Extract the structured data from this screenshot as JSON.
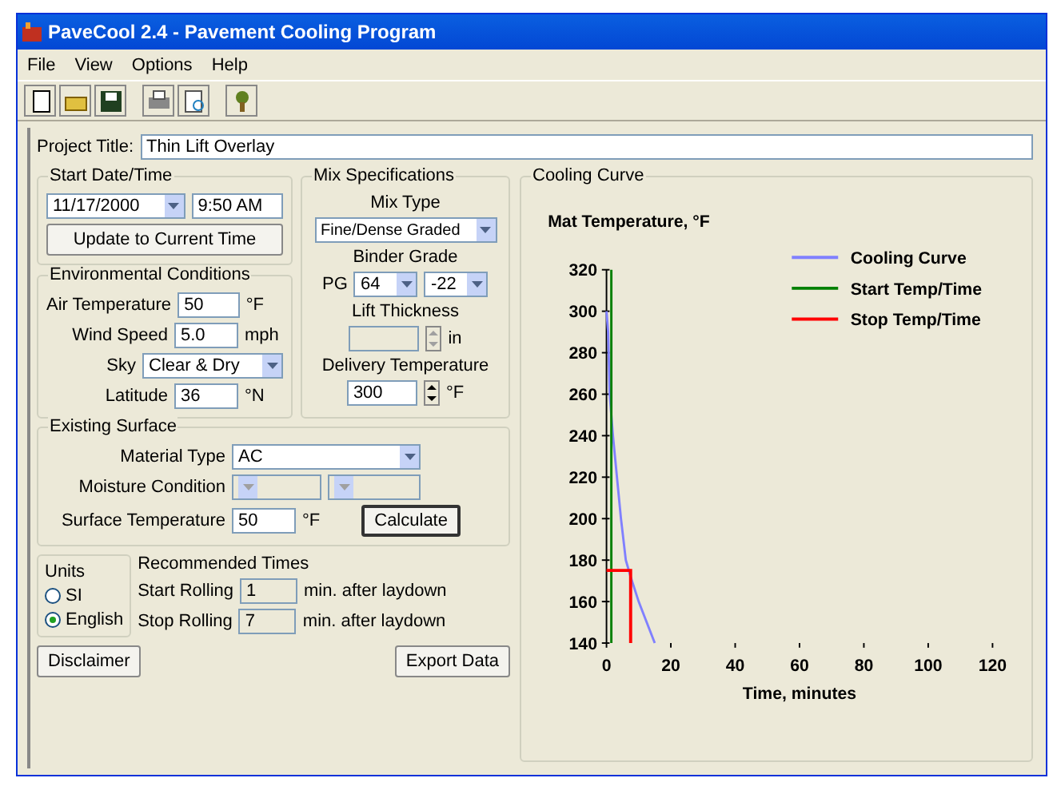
{
  "window": {
    "title": "PaveCool 2.4 - Pavement Cooling Program"
  },
  "menu": [
    {
      "label": "File"
    },
    {
      "label": "View"
    },
    {
      "label": "Options"
    },
    {
      "label": "Help"
    }
  ],
  "project_title": {
    "label": "Project Title:",
    "value": "Thin Lift Overlay"
  },
  "start_datetime": {
    "title": "Start Date/Time",
    "date": "11/17/2000",
    "time": "9:50 AM",
    "button": "Update to Current Time"
  },
  "environment": {
    "title": "Environmental Conditions",
    "fields": [
      {
        "kind": "text",
        "label": "Air Temperature",
        "value": "50",
        "unit": "°F"
      },
      {
        "kind": "text",
        "label": "Wind Speed",
        "value": "5.0",
        "unit": "mph"
      },
      {
        "kind": "dropdown",
        "label": "Sky",
        "value": "Clear & Dry"
      },
      {
        "kind": "text",
        "label": "Latitude",
        "value": "36",
        "unit": "°N"
      }
    ]
  },
  "mix": {
    "title": "Mix Specifications",
    "mix_type_label": "Mix Type",
    "mix_type": "Fine/Dense Graded",
    "binder_label": "Binder Grade",
    "pg_label": "PG",
    "binder_high": "64",
    "binder_low": "-22",
    "lift_label": "Lift Thickness",
    "lift_unit": "in",
    "lift_disabled": true,
    "delivery_label": "Delivery Temperature",
    "delivery_value": "300",
    "delivery_unit": "°F"
  },
  "existing_surface": {
    "title": "Existing Surface",
    "material_label": "Material Type",
    "material": "AC",
    "moisture_label": "Moisture Condition",
    "moisture_disabled": true,
    "surface_temp_label": "Surface Temperature",
    "surface_temp": "50",
    "surface_temp_unit": "°F",
    "calculate": "Calculate"
  },
  "units": {
    "title": "Units",
    "options": [
      {
        "label": "SI",
        "selected": false
      },
      {
        "label": "English",
        "selected": true
      }
    ]
  },
  "recommended": {
    "title": "Recommended Times",
    "rows": [
      {
        "label": "Start Rolling",
        "value": "1",
        "suffix": "min. after laydown"
      },
      {
        "label": "Stop Rolling",
        "value": "7",
        "suffix": "min. after laydown"
      }
    ]
  },
  "buttons": [
    {
      "label": "Disclaimer"
    },
    {
      "label": "Export Data"
    }
  ],
  "cooling_curve": {
    "title": "Cooling Curve",
    "chart_data": {
      "type": "line",
      "ylabel": "Mat Temperature, °F",
      "xlabel": "Time, minutes",
      "legend": "upper right",
      "series": [
        {
          "name": "Cooling Curve",
          "color": "#8080ff",
          "x": [
            0,
            0.5,
            1,
            2,
            4.5,
            6,
            7.5,
            10,
            15
          ],
          "values": [
            300,
            290,
            260,
            240,
            200,
            180,
            172,
            160,
            140
          ]
        },
        {
          "name": "Start Temp/Time",
          "color": "#008000",
          "x": [
            1.5,
            1.5
          ],
          "values": [
            320,
            140
          ]
        },
        {
          "name": "Stop Temp/Time",
          "color": "#ff0000",
          "x": [
            0,
            7.5,
            7.5
          ],
          "values": [
            175,
            175,
            140
          ]
        }
      ],
      "xlim": [
        0,
        120
      ],
      "ylim": [
        140,
        320
      ],
      "xticks": [
        0,
        20,
        40,
        60,
        80,
        100,
        120
      ],
      "yticks": [
        140,
        160,
        180,
        200,
        220,
        240,
        260,
        280,
        300,
        320
      ]
    }
  }
}
